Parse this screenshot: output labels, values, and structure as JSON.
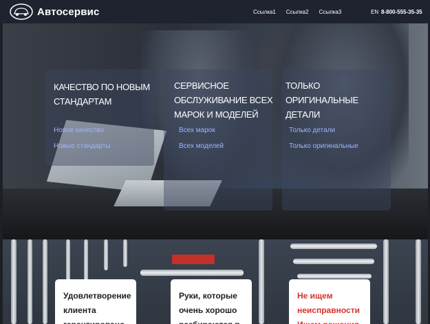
{
  "header": {
    "brand": "Автосервис",
    "nav": [
      "Ссылка1",
      "Ссылка2",
      "Ссылка3"
    ],
    "lang": "EN",
    "phone": "8-800-555-35-35"
  },
  "hero": {
    "cards": [
      {
        "title_lines": [
          "КАЧЕСТВО ПО НОВЫМ",
          "СТАНДАРТАМ"
        ],
        "links": [
          "Новое качество",
          "Новые стандарты"
        ]
      },
      {
        "title_lines": [
          "СЕРВИСНОЕ",
          "ОБСЛУЖИВАНИЕ ВСЕХ",
          "МАРОК И МОДЕЛЕЙ"
        ],
        "links": [
          "Всех марок",
          "Всех моделей"
        ]
      },
      {
        "title_lines": [
          "ТОЛЬКО ОРИГИНАЛЬНЫЕ",
          "ДЕТАЛИ"
        ],
        "links": [
          "Только детали",
          "Только оригинальные"
        ]
      }
    ]
  },
  "features": [
    {
      "lines": [
        "Удовлетворение",
        "клиента",
        "гарантировано"
      ]
    },
    {
      "lines": [
        "Руки, которые",
        "очень хорошо",
        "разбираются в"
      ]
    },
    {
      "lines": [
        "Не ищем",
        "неисправности",
        "Ищем решения"
      ]
    }
  ],
  "colors": {
    "header_bg": "#1f2330",
    "link": "#9fb4ff",
    "accent_red": "#d4322c"
  }
}
